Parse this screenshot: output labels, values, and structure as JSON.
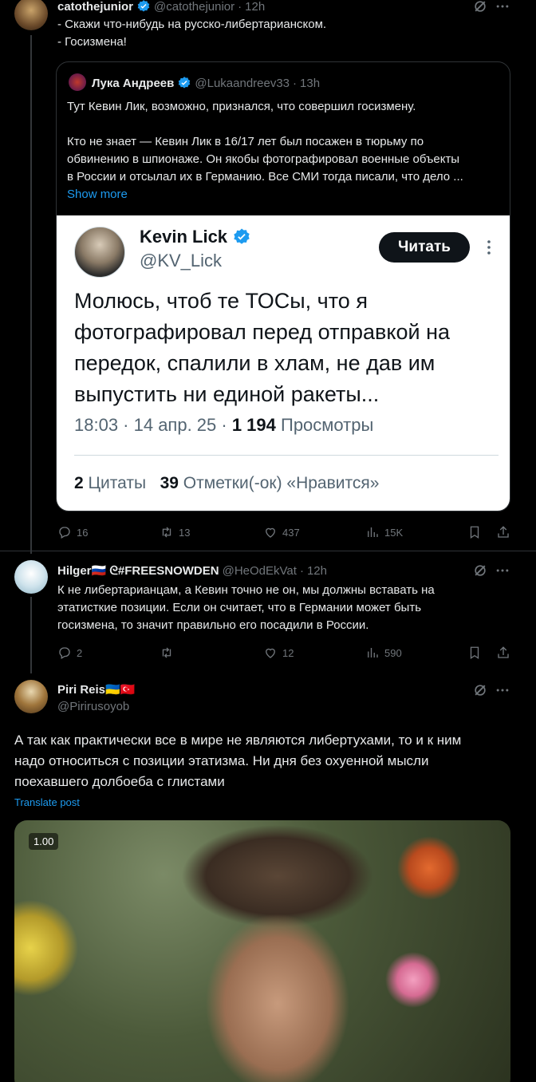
{
  "tweet1": {
    "name": "catothejunior",
    "handle": "@catothejunior",
    "time": "12h",
    "lines": [
      "- Скажи что-нибудь на русско-либертарианском.",
      "- Госизмена!"
    ],
    "quote": {
      "name": "Лука Андреев",
      "handle": "@Lukaandreev33",
      "time": "13h",
      "para1": "Тут Кевин Лик, возможно, признался, что совершил госизмену.",
      "para2_lines": [
        "Кто не знает — Кевин Лик в 16/17 лет был посажен в тюрьму по",
        "обвинению в шпионаже. Он якобы фотографировал военные объекты",
        "в России и отсылал их в Германию. Все СМИ тогда писали, что дело ..."
      ],
      "show_more": "Show more",
      "image": {
        "name": "Kevin Lick",
        "handle": "@KV_Lick",
        "button": "Читать",
        "text_lines": [
          "Молюсь, чтоб те ТОСы, что я",
          "фотографировал перед отправкой на",
          "передок, спалили в хлам, не дав им",
          "выпустить ни единой ракеты..."
        ],
        "meta_time": "18:03 · 14 апр. 25 · ",
        "meta_views_num": "1 194",
        "meta_views_label": " Просмотры",
        "quotes_num": "2",
        "quotes_label": " Цитаты ",
        "likes_num": "39",
        "likes_label": " Отметки(-ок) «Нравится»"
      }
    },
    "actions": {
      "replies": "16",
      "reposts": "13",
      "likes": "437",
      "views": "15K"
    }
  },
  "tweet2": {
    "name": "Hilger🇷🇺 ᘓ#FREESNOWDEN",
    "handle": "@HeOdEkVat",
    "time": "12h",
    "lines": [
      "К не либертарианцам, а Кевин точно не он, мы должны вставать на",
      "этатисткие позиции. Если он считает, что в Германии может быть",
      "госизмена, то значит правильно его посадили в России."
    ],
    "actions": {
      "replies": "2",
      "reposts": "",
      "likes": "12",
      "views": "590"
    }
  },
  "tweet3": {
    "name": "Piri Reis🇺🇦🇹🇷",
    "handle": "@Pirirusoyob",
    "lines": [
      "А так как практически все в мире не являются либертухами, то и к ним",
      "надо относиться с позиции этатизма. Ни дня без охуенной мысли",
      "поехавшего долбоеба с глистами"
    ],
    "translate": "Translate post",
    "video_speed": "1.00"
  },
  "icons": {
    "grok": "grok-icon",
    "more": "more-icon",
    "verified": "verified-badge-icon",
    "reply": "reply-icon",
    "repost": "repost-icon",
    "like": "heart-icon",
    "views": "views-icon",
    "bookmark": "bookmark-icon",
    "share": "share-icon"
  },
  "colors": {
    "background": "#000000",
    "text": "#e7e9ea",
    "muted": "#71767b",
    "link": "#1d9bf0",
    "verified": "#1d9bf0"
  }
}
